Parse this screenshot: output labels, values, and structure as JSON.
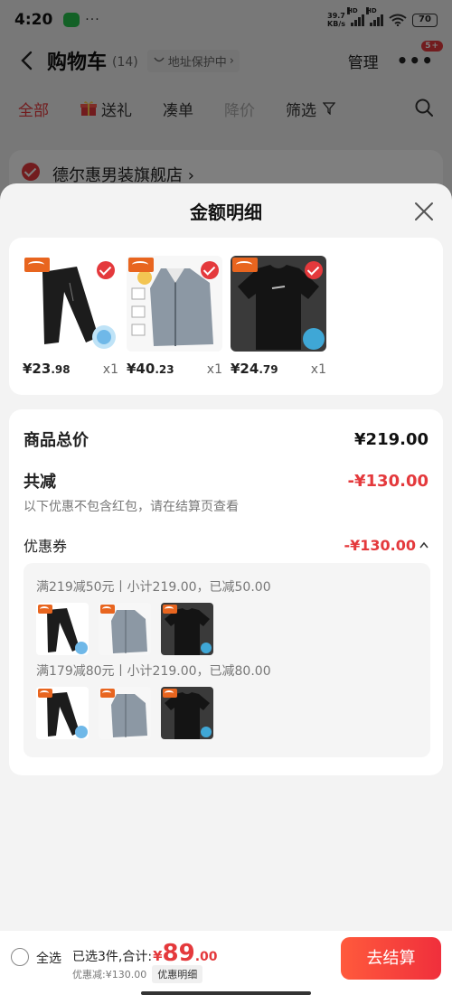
{
  "status_bar": {
    "time": "4:20",
    "dots": "···",
    "net_speed_value": "39.7",
    "net_speed_unit": "KB/s",
    "hd1": "HD",
    "hd2": "HD",
    "battery": "70"
  },
  "nav": {
    "title": "购物车",
    "count": "(14)",
    "address_protect": "地址保护中",
    "manage": "管理",
    "more_badge": "5+"
  },
  "tabs": [
    {
      "label": "全部"
    },
    {
      "label": "送礼"
    },
    {
      "label": "凑单"
    },
    {
      "label": "降价"
    },
    {
      "label": "筛选"
    }
  ],
  "store": {
    "name": "德尔惠男装旗舰店 ›"
  },
  "sheet": {
    "title": "金额明细",
    "products": [
      {
        "price_int": "¥23",
        "price_dec": ".98",
        "qty": "x1",
        "kind": "pants"
      },
      {
        "price_int": "¥40",
        "price_dec": ".23",
        "qty": "x1",
        "kind": "jacket"
      },
      {
        "price_int": "¥24",
        "price_dec": ".79",
        "qty": "x1",
        "kind": "tee"
      }
    ],
    "summary": {
      "total_label": "商品总价",
      "total_value": "¥219.00",
      "reduce_label": "共减",
      "reduce_value": "-¥130.00",
      "note": "以下优惠不包含红包，请在结算页查看",
      "coupon_label": "优惠券",
      "coupon_value": "-¥130.00"
    },
    "coupon_rules": [
      {
        "text": "满219减50元丨小计219.00，已减50.00"
      },
      {
        "text": "满179减80元丨小计219.00，已减80.00"
      }
    ]
  },
  "bottom": {
    "select_all": "全选",
    "total_label": "已选3件,合计:",
    "yen": "¥",
    "total_int": "89",
    "total_dec": ".00",
    "discount": "优惠减:¥130.00",
    "detail": "优惠明细",
    "checkout": "去结算"
  },
  "colors": {
    "accent": "#e4393c",
    "checkout_gradient_start": "#ff5a3c",
    "checkout_gradient_end": "#f02f3c"
  }
}
